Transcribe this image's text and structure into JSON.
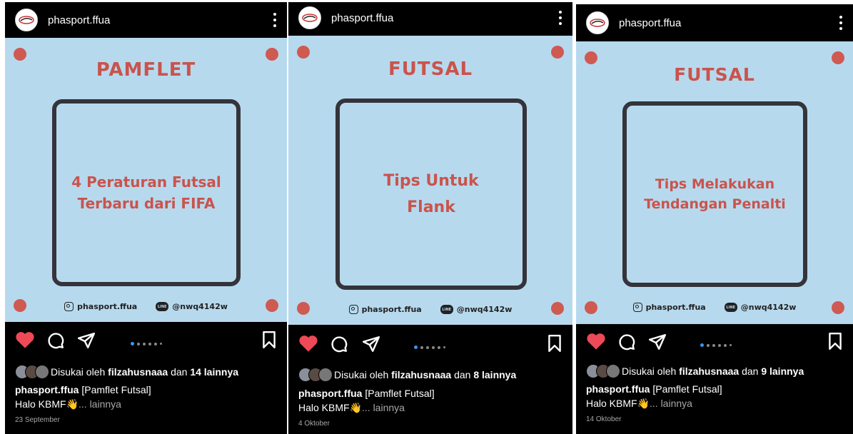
{
  "posts": [
    {
      "username": "phasport.ffua",
      "title": "PAMFLET",
      "frame_line1": "4 Peraturan Futsal",
      "frame_line2": "Terbaru dari FIFA",
      "instagram_handle": "phasport.ffua",
      "line_handle": "@nwq4142w",
      "likes_prefix": "Disukai oleh",
      "liker": "filzahusnaaa",
      "likes_mid": "dan",
      "likes_count": "14 lainnya",
      "caption_user": "phasport.ffua",
      "caption_text": "[Pamflet Futsal]",
      "caption_line2": "Halo KBMF",
      "caption_emoji": "👋",
      "more_text": "... lainnya",
      "date": "23 September"
    },
    {
      "username": "phasport.ffua",
      "title": "FUTSAL",
      "frame_line1": "Tips Untuk",
      "frame_line2": "Flank",
      "instagram_handle": "phasport.ffua",
      "line_handle": "@nwq4142w",
      "likes_prefix": "Disukai oleh",
      "liker": "filzahusnaaa",
      "likes_mid": "dan",
      "likes_count": "8 lainnya",
      "caption_user": "phasport.ffua",
      "caption_text": "[Pamflet Futsal]",
      "caption_line2": "Halo KBMF",
      "caption_emoji": "👋",
      "more_text": "... lainnya",
      "date": "4 Oktober"
    },
    {
      "username": "phasport.ffua",
      "title": "FUTSAL",
      "frame_line1": "Tips Melakukan",
      "frame_line2": "Tendangan Penalti",
      "instagram_handle": "phasport.ffua",
      "line_handle": "@nwq4142w",
      "likes_prefix": "Disukai oleh",
      "liker": "filzahusnaaa",
      "likes_mid": "dan",
      "likes_count": "9 lainnya",
      "caption_user": "phasport.ffua",
      "caption_text": "[Pamflet Futsal]",
      "caption_line2": "Halo KBMF",
      "caption_emoji": "👋",
      "more_text": "... lainnya",
      "date": "14 Oktober"
    }
  ],
  "icons": {
    "like": "heart-icon",
    "comment": "comment-icon",
    "share": "send-icon",
    "save": "bookmark-icon",
    "menu": "more-vertical-icon"
  },
  "colors": {
    "background": "#000000",
    "post_bg": "#b7d9ee",
    "accent_red": "#cf5a52",
    "like_red": "#ed4956",
    "carousel_active": "#3897f0"
  },
  "carousel": {
    "slides": 6,
    "active_index": 0
  }
}
